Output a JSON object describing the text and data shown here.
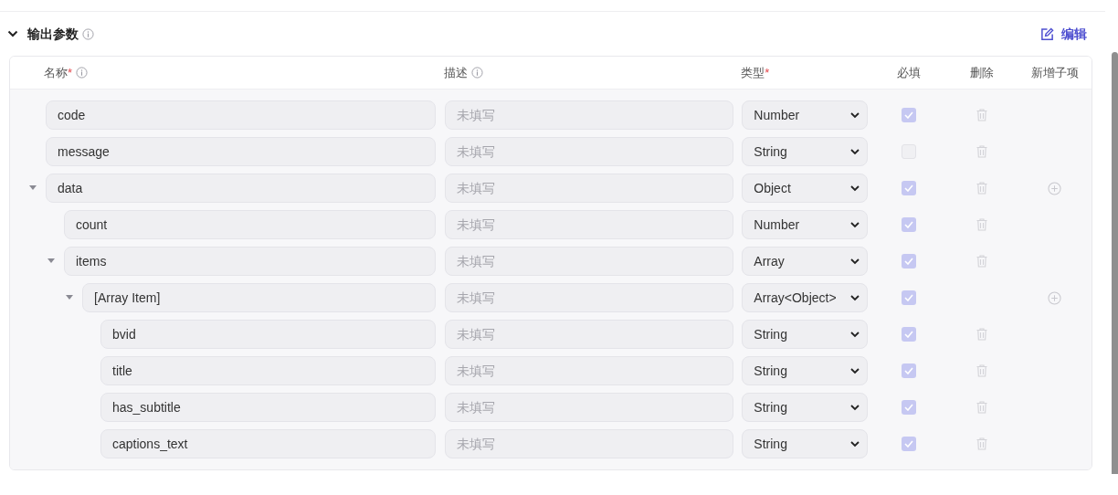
{
  "section": {
    "title": "输出参数",
    "expanded": true,
    "edit_button": "编辑"
  },
  "columns": [
    {
      "label": "名称",
      "required_mark": "*",
      "info": true
    },
    {
      "label": "描述",
      "info": true
    },
    {
      "label": "类型",
      "required_mark": "*"
    },
    {
      "label": "必填"
    },
    {
      "label": "删除"
    },
    {
      "label": "新增子项"
    }
  ],
  "rows": [
    {
      "name": "code",
      "description_placeholder": "未填写",
      "type": "Number",
      "required": true,
      "deletable": true,
      "can_add_child": false
    },
    {
      "name": "message",
      "description_placeholder": "未填写",
      "type": "String",
      "required": false,
      "deletable": true,
      "can_add_child": false
    },
    {
      "name": "data",
      "description_placeholder": "未填写",
      "type": "Object",
      "required": true,
      "deletable": true,
      "can_add_child": true,
      "expanded": true,
      "children": [
        {
          "name": "count",
          "description_placeholder": "未填写",
          "type": "Number",
          "required": true,
          "deletable": true,
          "can_add_child": false
        },
        {
          "name": "items",
          "description_placeholder": "未填写",
          "type": "Array",
          "required": true,
          "deletable": true,
          "can_add_child": false,
          "expanded": true,
          "children": [
            {
              "name": "[Array Item]",
              "description_placeholder": "未填写",
              "type": "Array<Object>",
              "required": true,
              "deletable": false,
              "can_add_child": true,
              "expanded": true,
              "children": [
                {
                  "name": "bvid",
                  "description_placeholder": "未填写",
                  "type": "String",
                  "required": true,
                  "deletable": true,
                  "can_add_child": false
                },
                {
                  "name": "title",
                  "description_placeholder": "未填写",
                  "type": "String",
                  "required": true,
                  "deletable": true,
                  "can_add_child": false
                },
                {
                  "name": "has_subtitle",
                  "description_placeholder": "未填写",
                  "type": "String",
                  "required": true,
                  "deletable": true,
                  "can_add_child": false
                },
                {
                  "name": "captions_text",
                  "description_placeholder": "未填写",
                  "type": "String",
                  "required": true,
                  "deletable": true,
                  "can_add_child": false
                }
              ]
            }
          ]
        }
      ]
    }
  ]
}
